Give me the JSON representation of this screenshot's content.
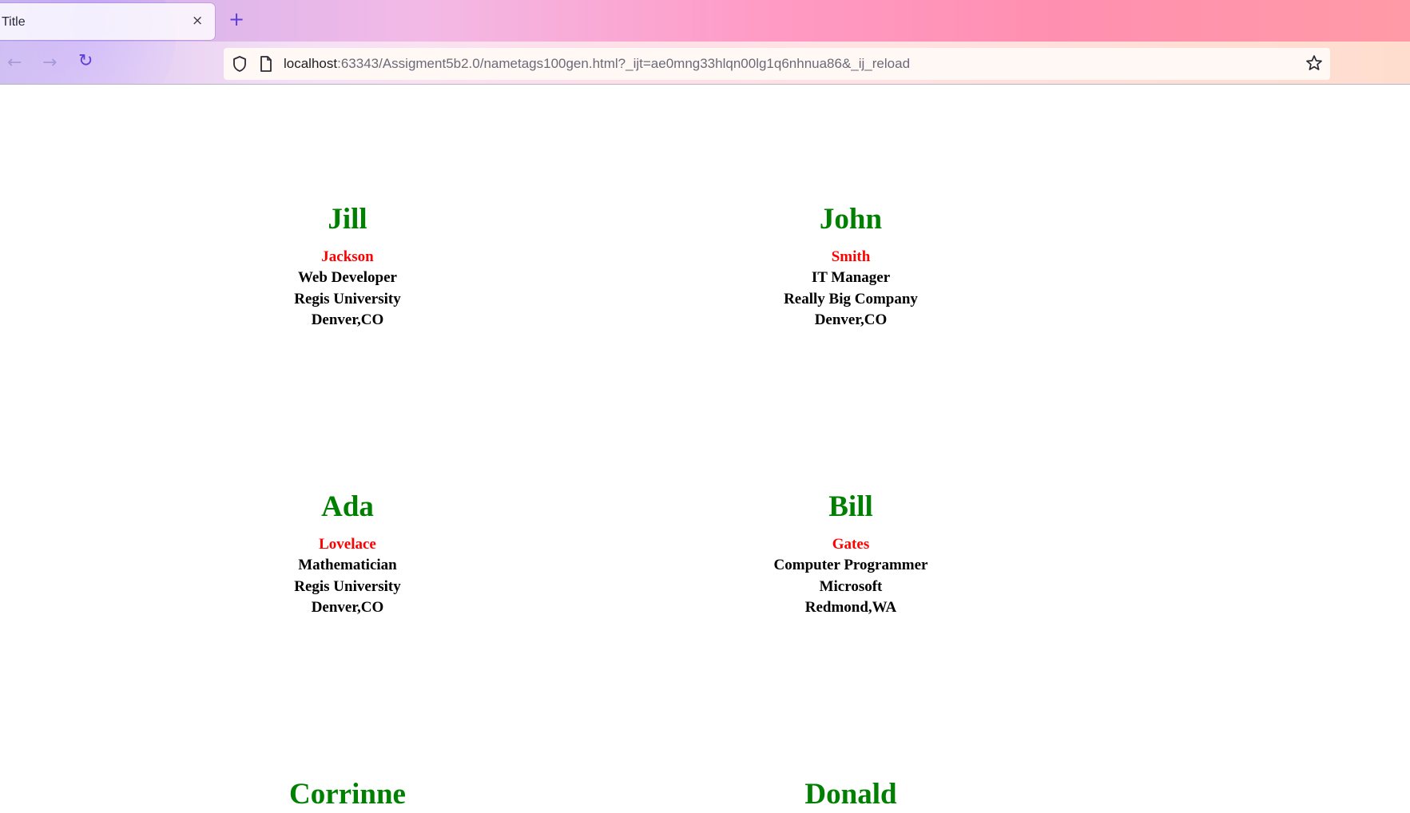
{
  "browser": {
    "tab_title": "Title",
    "tab_close": "×",
    "new_tab": "+",
    "back": "←",
    "forward": "→",
    "reload": "↻",
    "url_host": "localhost",
    "url_rest": ":63343/Assigment5b2.0/nametags100gen.html?_ijt=ae0mng33hlqn00lg1q6nhnua86&_ij_reload"
  },
  "nametags": [
    {
      "first": "Jill",
      "last": "Jackson",
      "title": "Web Developer",
      "company": "Regis University",
      "location": "Denver,CO"
    },
    {
      "first": "John",
      "last": "Smith",
      "title": "IT Manager",
      "company": "Really Big Company",
      "location": "Denver,CO"
    },
    {
      "first": "Ada",
      "last": "Lovelace",
      "title": "Mathematician",
      "company": "Regis University",
      "location": "Denver,CO"
    },
    {
      "first": "Bill",
      "last": "Gates",
      "title": "Computer Programmer",
      "company": "Microsoft",
      "location": "Redmond,WA"
    },
    {
      "first": "Corrinne",
      "last": "",
      "title": "",
      "company": "",
      "location": ""
    },
    {
      "first": "Donald",
      "last": "",
      "title": "",
      "company": "",
      "location": ""
    }
  ],
  "colors": {
    "first_name": "#008000",
    "last_name": "#ff0000",
    "info": "#000000",
    "accent": "#5b3fd6"
  }
}
